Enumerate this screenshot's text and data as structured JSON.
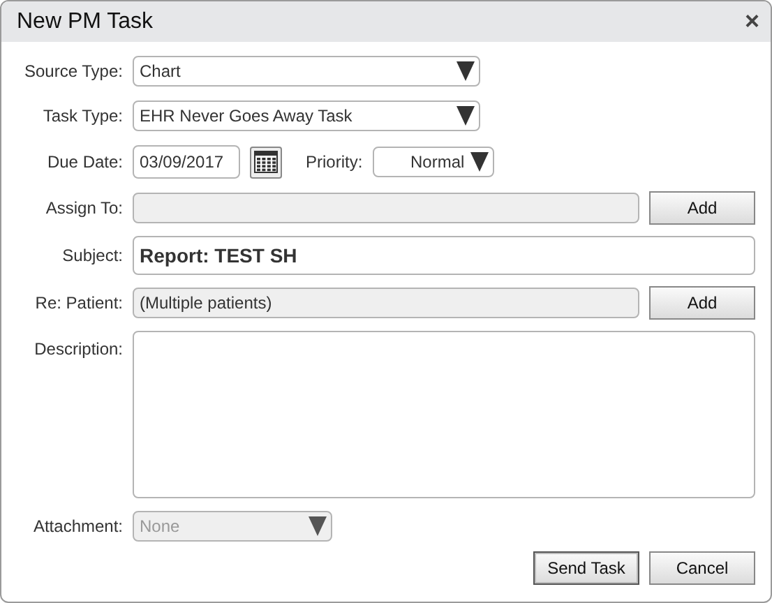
{
  "window": {
    "title": "New PM Task",
    "close": "×"
  },
  "source_type": {
    "label": "Source Type:",
    "value": "Chart",
    "disabled": false
  },
  "task_type": {
    "label": "Task Type:",
    "value": "EHR Never Goes Away Task",
    "disabled": false
  },
  "due_date": {
    "label": "Due Date:",
    "value": "03/09/2017"
  },
  "priority": {
    "label": "Priority:",
    "value": "Normal",
    "disabled": false
  },
  "assign_to": {
    "label": "Assign To:",
    "disabled": true,
    "button": "Add"
  },
  "subject": {
    "label": "Subject:",
    "value": "Report: TEST SH"
  },
  "re_patient": {
    "label": "Re: Patient:",
    "value": "(Multiple patients)",
    "disabled": true,
    "button": "Add"
  },
  "description": {
    "label": "Description:"
  },
  "attachment": {
    "label": "Attachment:",
    "value": "None",
    "disabled": true
  },
  "buttons": [
    {
      "label": "Send Task",
      "default": true
    },
    {
      "label": "Cancel",
      "default": false
    }
  ]
}
